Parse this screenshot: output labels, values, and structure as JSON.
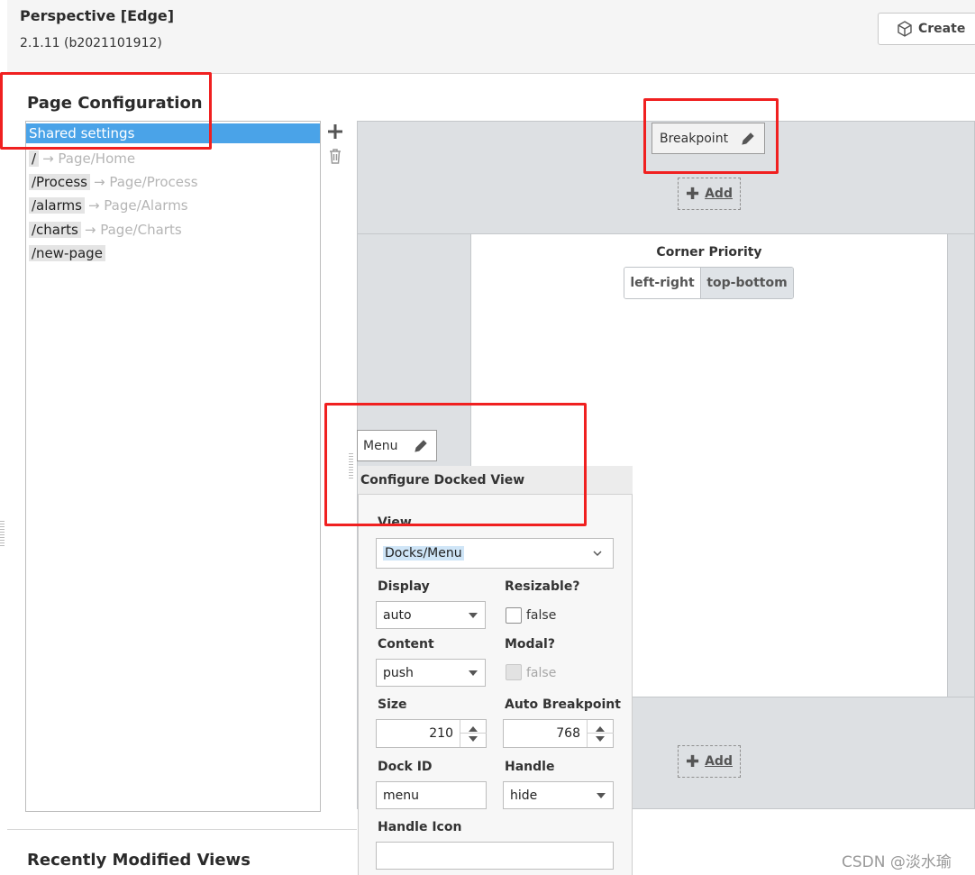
{
  "header": {
    "title": "Perspective [Edge]",
    "version": "2.1.11 (b2021101912)",
    "create_label": "Create"
  },
  "section_title": "Page Configuration",
  "page_list": {
    "selected_label": "Shared settings",
    "items": [
      {
        "path": "/",
        "target": "Page/Home"
      },
      {
        "path": "/Process",
        "target": "Page/Process"
      },
      {
        "path": "/alarms",
        "target": "Page/Alarms"
      },
      {
        "path": "/charts",
        "target": "Page/Charts"
      },
      {
        "path": "/new-page",
        "target": ""
      }
    ],
    "arrow": "→"
  },
  "canvas": {
    "breakpoint_label": "Breakpoint",
    "add_label": "Add",
    "corner_priority": {
      "label": "Corner Priority",
      "options": [
        "left-right",
        "top-bottom"
      ],
      "selected": "top-bottom"
    },
    "menu_label": "Menu"
  },
  "docked_config": {
    "title": "Configure Docked View",
    "view_label": "View",
    "view_value": "Docks/Menu",
    "display_label": "Display",
    "display_value": "auto",
    "resizable_label": "Resizable?",
    "resizable_value": "false",
    "content_label": "Content",
    "content_value": "push",
    "modal_label": "Modal?",
    "modal_value": "false",
    "size_label": "Size",
    "size_value": "210",
    "auto_breakpoint_label": "Auto Breakpoint",
    "auto_breakpoint_value": "768",
    "dock_id_label": "Dock ID",
    "dock_id_value": "menu",
    "handle_label": "Handle",
    "handle_value": "hide",
    "handle_icon_label": "Handle Icon",
    "handle_icon_value": ""
  },
  "footer": {
    "recent_title": "Recently Modified Views",
    "watermark": "CSDN @淡水瑜"
  },
  "colors": {
    "selection": "#4aa3e8",
    "annotation": "#f02020",
    "canvas": "#dde0e3"
  }
}
